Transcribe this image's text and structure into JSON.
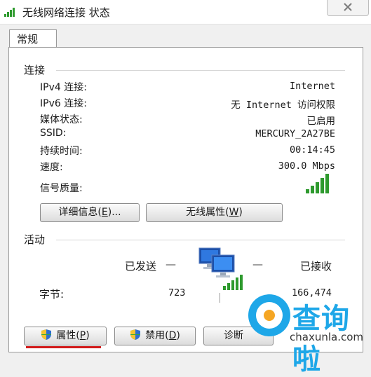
{
  "window": {
    "title": "无线网络连接 状态"
  },
  "tabs": [
    {
      "label": "常规"
    }
  ],
  "connection": {
    "section_label": "连接",
    "rows": [
      {
        "label": "IPv4 连接:",
        "value": "Internet"
      },
      {
        "label": "IPv6 连接:",
        "value": "无 Internet 访问权限"
      },
      {
        "label": "媒体状态:",
        "value": "已启用"
      },
      {
        "label": "SSID:",
        "value": "MERCURY_2A27BE"
      },
      {
        "label": "持续时间:",
        "value": "00:14:45"
      },
      {
        "label": "速度:",
        "value": "300.0 Mbps"
      }
    ],
    "signal": {
      "label": "信号质量:",
      "bars_lit": 5,
      "bars_total": 5
    }
  },
  "buttons": {
    "details": {
      "text": "详细信息(",
      "key": "E",
      "suffix": ")..."
    },
    "wireless_props": {
      "text": "无线属性(",
      "key": "W",
      "suffix": ")"
    },
    "properties": {
      "text": "属性(",
      "key": "P",
      "suffix": ")"
    },
    "disable": {
      "text": "禁用(",
      "key": "D",
      "suffix": ")"
    },
    "diagnose": {
      "text": "诊断"
    }
  },
  "activity": {
    "section_label": "活动",
    "sent_label": "已发送",
    "received_label": "已接收",
    "bytes_label": "字节:",
    "bytes_sent": "723",
    "bytes_received": "166,474",
    "dash": "—"
  },
  "watermark": {
    "cn": "查询啦",
    "en": "chaxunla.com"
  },
  "colors": {
    "signal_green": "#2e9a2e",
    "watermark_blue": "#1ea7e8",
    "underline_red": "#d11a1a"
  }
}
